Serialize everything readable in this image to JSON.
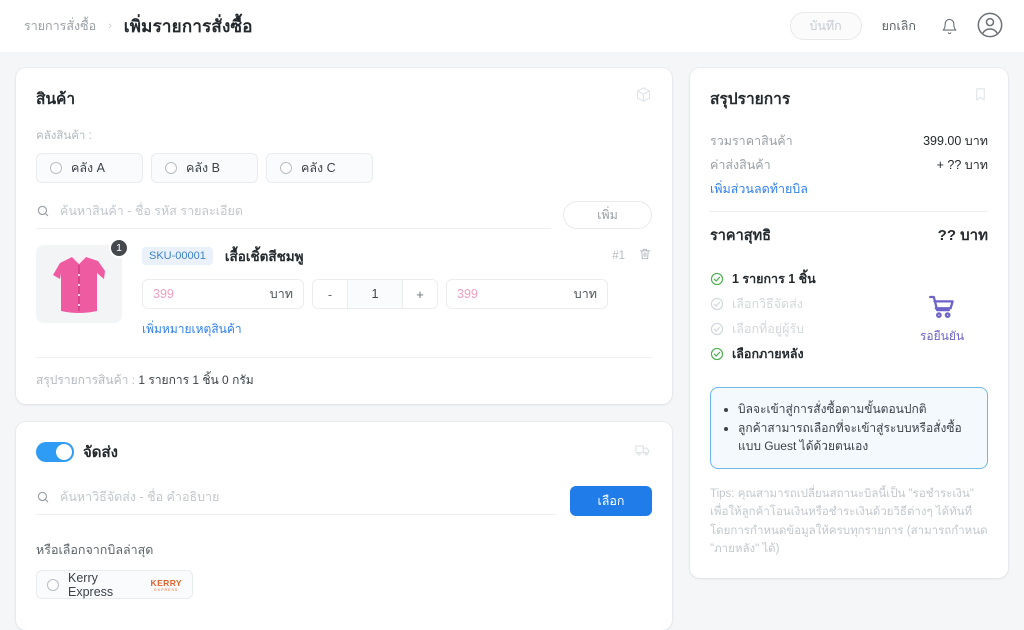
{
  "topbar": {
    "breadcrumb_root": "รายการสั่งซื้อ",
    "breadcrumb_sep": "›",
    "breadcrumb_current": "เพิ่มรายการสั่งซื้อ",
    "save_label": "บันทึก",
    "cancel_label": "ยกเลิก",
    "notification_icon": "bell-icon",
    "account_icon": "user-avatar-icon"
  },
  "product_card": {
    "title": "สินค้า",
    "corner_icon": "box-3d-icon",
    "warehouse_label": "คลังสินค้า :",
    "warehouses": [
      {
        "label": "คลัง A",
        "selected": false
      },
      {
        "label": "คลัง B",
        "selected": false
      },
      {
        "label": "คลัง C",
        "selected": false
      }
    ],
    "search_placeholder": "ค้นหาสินค้า - ชื่อ รหัส รายละเอียด",
    "search_value": "",
    "add_label": "เพิ่ม",
    "items": [
      {
        "badge_qty": "1",
        "sku": "SKU-00001",
        "name": "เสื้อเชิ้ตสีชมพู",
        "seq": "#1",
        "delete_icon": "trash-icon",
        "unit_price_value": "399",
        "unit_price_unit": "บาท",
        "qty_minus": "-",
        "qty_value": "1",
        "qty_plus": "+",
        "total_price_value": "399",
        "total_price_unit": "บาท",
        "note_link": "เพิ่มหมายเหตุสินค้า"
      }
    ],
    "summary_label": "สรุปรายการสินค้า :",
    "summary_value": "1 รายการ 1 ชิ้น 0 กรัม"
  },
  "shipping_card": {
    "toggle_label": "จัดส่ง",
    "toggle_on": true,
    "corner_icon": "truck-icon",
    "search_placeholder": "ค้นหาวิธีจัดส่ง - ชื่อ คำอธิบาย",
    "search_value": "",
    "choose_label": "เลือก",
    "recent_label": "หรือเลือกจากบิลล่าสุด",
    "carriers": [
      {
        "label": "Kerry Express",
        "logo_line1": "KERRY",
        "logo_line2": "EXPRESS",
        "selected": false
      }
    ]
  },
  "summary_card": {
    "title": "สรุปรายการ",
    "bookmark_icon": "bookmark-icon",
    "rows": [
      {
        "key": "รวมราคาสินค้า",
        "value": "399.00 บาท"
      },
      {
        "key": "ค่าส่งสินค้า",
        "value": "+ ?? บาท"
      }
    ],
    "discount_link": "เพิ่มส่วนลดท้ายบิล",
    "net_key": "ราคาสุทธิ",
    "net_value": "?? บาท",
    "checklist": [
      {
        "label": "1 รายการ 1 ชิ้น",
        "state": "done"
      },
      {
        "label": "เลือกวิธีจัดส่ง",
        "state": "todo"
      },
      {
        "label": "เลือกที่อยู่ผู้รับ",
        "state": "todo"
      },
      {
        "label": "เลือกภายหลัง",
        "state": "done"
      }
    ],
    "cart_icon": "shopping-cart-icon",
    "cart_status": "รอยืนยัน",
    "info_bullets": [
      "บิลจะเข้าสู่การสั่งซื้อตามขั้นตอนปกติ",
      "ลูกค้าสามารถเลือกที่จะเข้าสู่ระบบหรือสั่งซื้อแบบ Guest ได้ด้วยตนเอง"
    ],
    "tips": "Tips: คุณสามารถเปลี่ยนสถานะบิลนี้เป็น \"รอชำระเงิน\" เพื่อให้ลูกค้าโอนเงินหรือชำระเงินด้วยวิธีต่างๆ ได้ทันที โดยการกำหนดข้อมูลให้ครบทุกรายการ (สามารถกำหนด \"ภายหลัง\" ได้)"
  },
  "colors": {
    "accent_blue": "#1f7ce8",
    "link_blue": "#2f80ed",
    "toggle_blue": "#2e9bf5",
    "check_green": "#4caf50",
    "cart_purple": "#6c63c9",
    "price_pink": "#f2a0bf",
    "kerry_orange": "#e2622c",
    "info_border": "#6cb8e8"
  }
}
